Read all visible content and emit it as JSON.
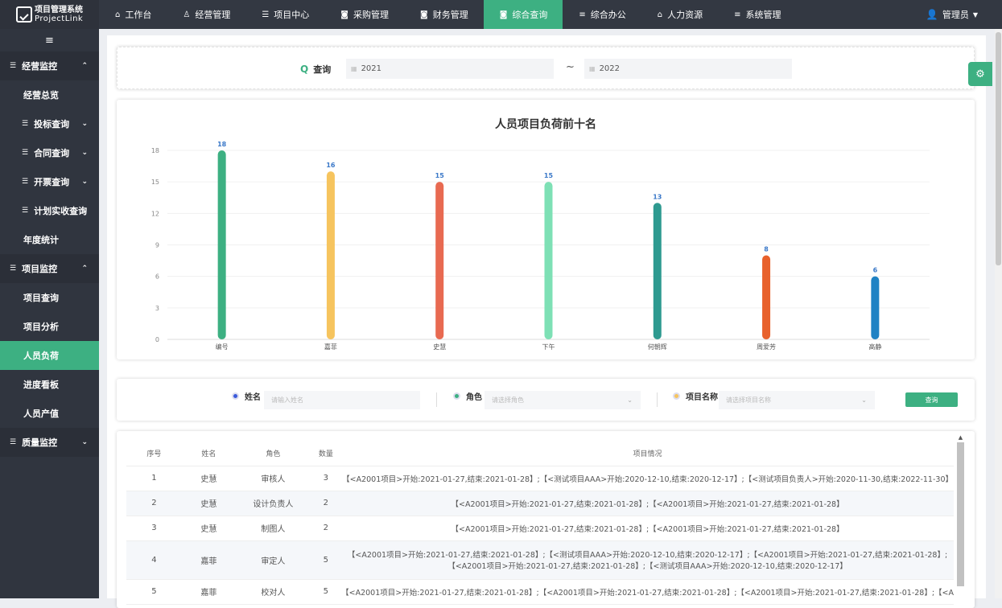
{
  "app": {
    "name_cn": "项目管理系统",
    "name_en": "ProjectLink"
  },
  "topnav": [
    {
      "label": "工作台",
      "icon": "home-icon"
    },
    {
      "label": "经营管理",
      "icon": "people-icon"
    },
    {
      "label": "项目中心",
      "icon": "list-icon"
    },
    {
      "label": "采购管理",
      "icon": "chart-icon"
    },
    {
      "label": "财务管理",
      "icon": "chart-icon"
    },
    {
      "label": "综合查询",
      "icon": "chart-icon",
      "active": true
    },
    {
      "label": "综合办公",
      "icon": "sliders-icon"
    },
    {
      "label": "人力资源",
      "icon": "home-icon"
    },
    {
      "label": "系统管理",
      "icon": "sliders-icon"
    }
  ],
  "user": {
    "name": "管理员"
  },
  "sidebar": {
    "items": [
      {
        "label": "经营监控",
        "type": "group"
      },
      {
        "label": "经营总览",
        "type": "sub"
      },
      {
        "label": "投标查询",
        "type": "subgroup"
      },
      {
        "label": "合同查询",
        "type": "subgroup"
      },
      {
        "label": "开票查询",
        "type": "subgroup"
      },
      {
        "label": "计划实收查询",
        "type": "subgroup"
      },
      {
        "label": "年度统计",
        "type": "sub"
      },
      {
        "label": "项目监控",
        "type": "group"
      },
      {
        "label": "项目查询",
        "type": "sub"
      },
      {
        "label": "项目分析",
        "type": "sub"
      },
      {
        "label": "人员负荷",
        "type": "sub",
        "active": true
      },
      {
        "label": "进度看板",
        "type": "sub"
      },
      {
        "label": "人员产值",
        "type": "sub"
      },
      {
        "label": "质量监控",
        "type": "group"
      }
    ]
  },
  "query": {
    "label": "查询",
    "start_year": "2021",
    "end_year": "2022",
    "separator": "~"
  },
  "chart_data": {
    "type": "bar",
    "title": "人员项目负荷前十名",
    "categories": [
      "编号",
      "嘉菲",
      "史慧",
      "下午",
      "何朝辉",
      "周爱芳",
      "高静"
    ],
    "values": [
      18,
      16,
      15,
      15,
      13,
      8,
      6
    ],
    "colors": [
      "#3db082",
      "#f6c45e",
      "#e86a51",
      "#7ee0b5",
      "#2e9a90",
      "#e8612c",
      "#1f82c4"
    ],
    "yticks": [
      0,
      3,
      6,
      9,
      12,
      15,
      18
    ],
    "ylim": [
      0,
      18
    ],
    "grid": true,
    "label_color": "#3a78c8"
  },
  "filters": {
    "name_label": "姓名",
    "name_placeholder": "请输入姓名",
    "role_label": "角色",
    "role_placeholder": "请选择角色",
    "project_label": "项目名称",
    "project_placeholder": "请选择项目名称",
    "search_label": "查询",
    "colors": {
      "name": "#3b5bdb",
      "role": "#3db082",
      "project": "#f6c45e"
    }
  },
  "table": {
    "headers": [
      "序号",
      "姓名",
      "角色",
      "数量",
      "项目情况"
    ],
    "rows": [
      {
        "no": "1",
        "name": "史慧",
        "role": "审核人",
        "count": "3",
        "detail": "【<A2001项目>开始:2021-01-27,结束:2021-01-28】;【<测试项目AAA>开始:2020-12-10,结束:2020-12-17】;【<测试项目负责人>开始:2020-11-30,结束:2022-11-30】"
      },
      {
        "no": "2",
        "name": "史慧",
        "role": "设计负责人",
        "count": "2",
        "detail": "【<A2001项目>开始:2021-01-27,结束:2021-01-28】;【<A2001项目>开始:2021-01-27,结束:2021-01-28】"
      },
      {
        "no": "3",
        "name": "史慧",
        "role": "制图人",
        "count": "2",
        "detail": "【<A2001项目>开始:2021-01-27,结束:2021-01-28】;【<A2001项目>开始:2021-01-27,结束:2021-01-28】"
      },
      {
        "no": "4",
        "name": "嘉菲",
        "role": "审定人",
        "count": "5",
        "detail": "【<A2001项目>开始:2021-01-27,结束:2021-01-28】;【<测试项目AAA>开始:2020-12-10,结束:2020-12-17】;【<A2001项目>开始:2021-01-27,结束:2021-01-28】;",
        "detail2": "【<A2001项目>开始:2021-01-27,结束:2021-01-28】;【<测试项目AAA>开始:2020-12-10,结束:2020-12-17】"
      },
      {
        "no": "5",
        "name": "嘉菲",
        "role": "校对人",
        "count": "5",
        "detail": "【<A2001项目>开始:2021-01-27,结束:2021-01-28】;【<A2001项目>开始:2021-01-27,结束:2021-01-28】;【<A2001项目>开始:2021-01-27,结束:2021-01-28】;【<A"
      }
    ]
  }
}
